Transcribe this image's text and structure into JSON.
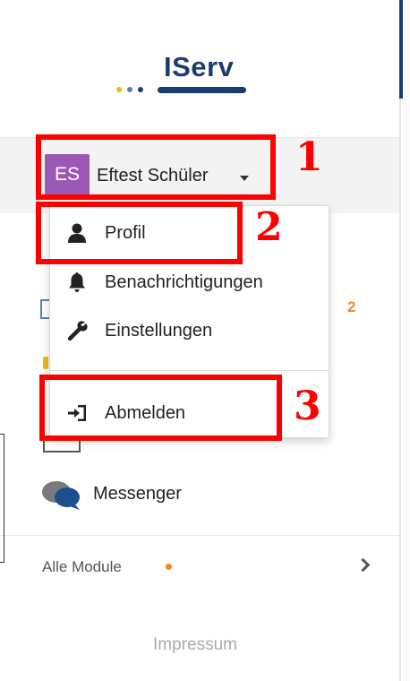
{
  "logo": {
    "text": "IServ",
    "dots": [
      "#f2b619",
      "#5a7fb0",
      "#1b3d6e"
    ]
  },
  "user": {
    "initials": "ES",
    "name": "Eftest Schüler",
    "avatar_color": "#9b59b6"
  },
  "menu": {
    "items": [
      {
        "label": "Profil",
        "icon": "user-icon"
      },
      {
        "label": "Benachrichtigungen",
        "icon": "bell-icon"
      },
      {
        "label": "Einstellungen",
        "icon": "wrench-icon"
      },
      {
        "label": "Abmelden",
        "icon": "sign-out-icon"
      }
    ]
  },
  "sidebar": {
    "mail_badge": "2",
    "messenger": "Messenger",
    "all_modules": "Alle Module",
    "impressum": "Impressum"
  },
  "annotations": [
    "1",
    "2",
    "3"
  ],
  "colors": {
    "brand": "#1b3d6e",
    "accent": "#f08a1c",
    "highlight": "#ff0000"
  }
}
